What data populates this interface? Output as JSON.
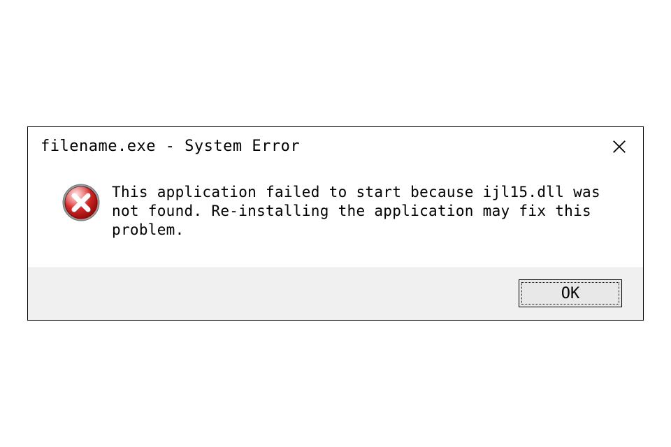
{
  "dialog": {
    "title": "filename.exe - System Error",
    "message": "This application failed to start because ijl15.dll was not found. Re-installing the application may fix this problem.",
    "ok_label": "OK",
    "icon": "error-x-icon",
    "close_icon": "close-x-icon",
    "colors": {
      "error_red": "#c22121",
      "error_red_light": "#e03232",
      "error_shine": "#ffffff"
    }
  }
}
